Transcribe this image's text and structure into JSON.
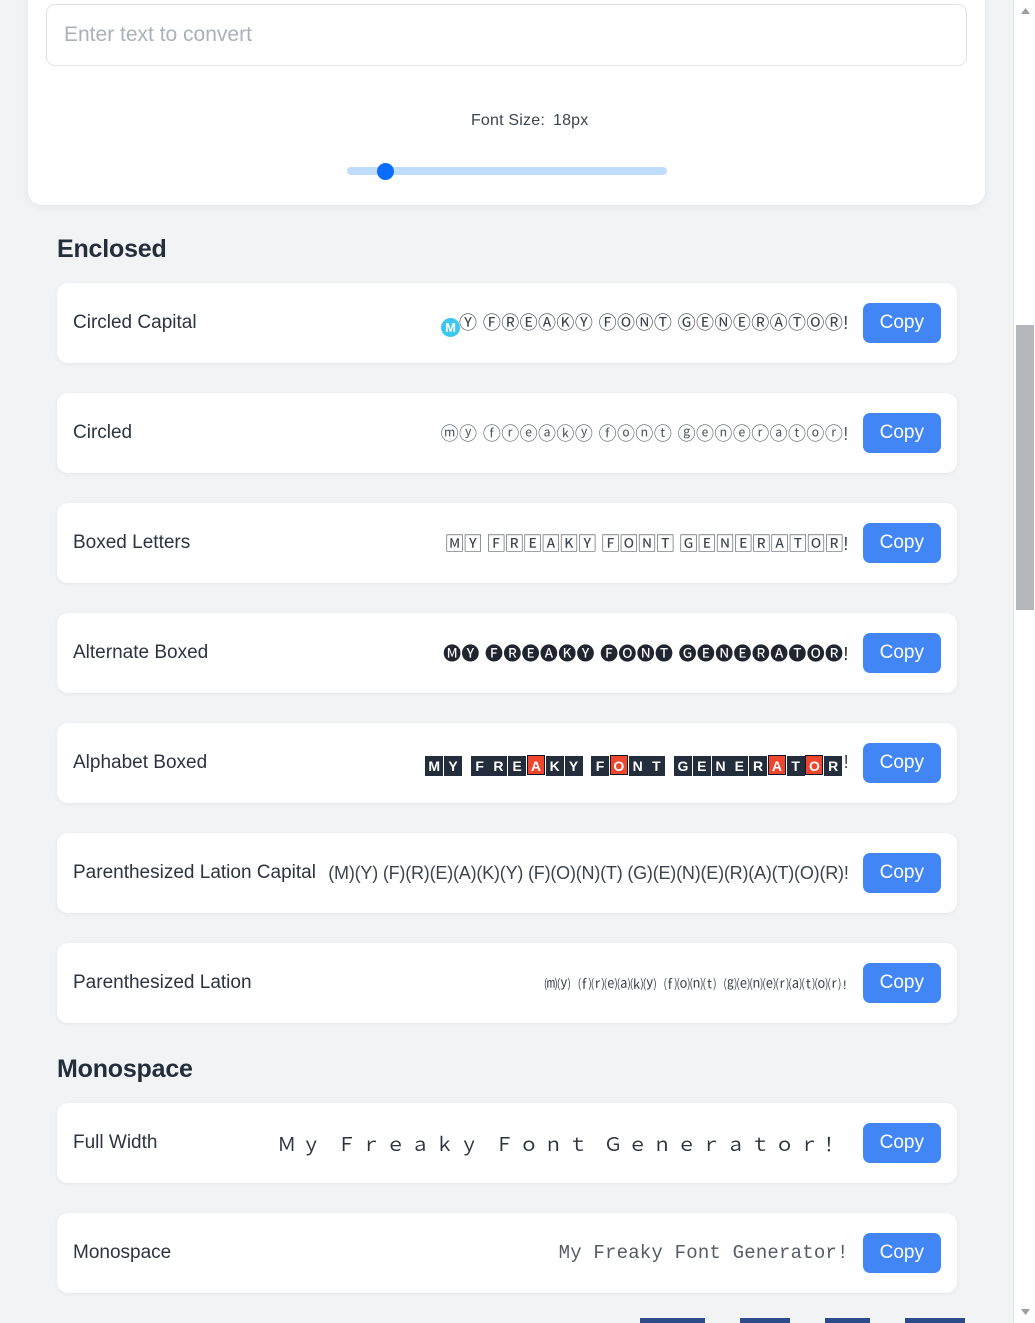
{
  "app": {
    "background_color": "#f1f3f5",
    "accent_color": "#4285f4"
  },
  "input_card": {
    "placeholder": "Enter text to convert",
    "value": "",
    "slider": {
      "label": "Font Size:",
      "value_label": "18px",
      "value": 18,
      "min": 10,
      "max": 72,
      "percent": 12,
      "track_color": "#bfdbfe",
      "thumb_color": "#0b6efd"
    }
  },
  "sections": [
    {
      "title": "Enclosed",
      "rows": [
        {
          "label": "Circled Capital",
          "preview": "Ⓜ",
          "preview_rest": "Ⓨ ⒻⓇⒺⒶⓀⓎ ⒻⓄⓃⓉ ⒼⒺⓃⒺⓇⒶⓉⓄⓇ!",
          "style": "pv-circled-cap",
          "copy_label": "Copy"
        },
        {
          "label": "Circled",
          "preview": "ⓜⓨ ⓕⓡⓔⓐⓚⓨ ⓕⓞⓝⓣ ⓖⓔⓝⓔⓡⓐⓣⓞⓡ!",
          "style": "pv-circled",
          "copy_label": "Copy"
        },
        {
          "label": "Boxed Letters",
          "preview": "🄼🅈 🄵🅁🄴🄰🄺🅈 🄵🄾🄽🅃 🄶🄴🄽🄴🅁🄰🅃🄾🅁!",
          "style": "pv-boxed",
          "copy_label": "Copy"
        },
        {
          "label": "Alternate Boxed",
          "preview": "🅜🅨 🅕🅡🅔🅐🅚🅨 🅕🅞🅝🅣 🅖🅔🅝🅔🅡🅐🅣🅞🅡!",
          "style": "pv-alt-boxed",
          "copy_label": "Copy"
        },
        {
          "label": "Alphabet Boxed",
          "preview": "MY FREAKY FONT GENERATOR!",
          "tiles": [
            {
              "ch": "M",
              "vowel": false
            },
            {
              "ch": "Y",
              "vowel": false
            },
            {
              "ch": " ",
              "vowel": false
            },
            {
              "ch": "F",
              "vowel": false
            },
            {
              "ch": "R",
              "vowel": false
            },
            {
              "ch": "E",
              "vowel": false
            },
            {
              "ch": "A",
              "vowel": true
            },
            {
              "ch": "K",
              "vowel": false
            },
            {
              "ch": "Y",
              "vowel": false
            },
            {
              "ch": " ",
              "vowel": false
            },
            {
              "ch": "F",
              "vowel": false
            },
            {
              "ch": "O",
              "vowel": true
            },
            {
              "ch": "N",
              "vowel": false
            },
            {
              "ch": "T",
              "vowel": false
            },
            {
              "ch": " ",
              "vowel": false
            },
            {
              "ch": "G",
              "vowel": false
            },
            {
              "ch": "E",
              "vowel": false
            },
            {
              "ch": "N",
              "vowel": false
            },
            {
              "ch": "E",
              "vowel": false
            },
            {
              "ch": "R",
              "vowel": false
            },
            {
              "ch": "A",
              "vowel": true
            },
            {
              "ch": "T",
              "vowel": false
            },
            {
              "ch": "O",
              "vowel": true
            },
            {
              "ch": "R",
              "vowel": false
            }
          ],
          "trailing": "!",
          "style": "pv-alpha-boxed",
          "tile_color": "#242d3c",
          "vowel_color": "#f0462d",
          "copy_label": "Copy"
        },
        {
          "label": "Parenthesized Lation Capital",
          "preview": "(M)(Y) (F)(R)(E)(A)(K)(Y) (F)(O)(N)(T) (G)(E)(N)(E)(R)(A)(T)(O)(R)!",
          "style": "pv-paren-cap",
          "copy_label": "Copy"
        },
        {
          "label": "Parenthesized Lation",
          "preview": "⒨⒴ ⒡⒭⒠⒜⒦⒴ ⒡⒪⒩⒯ ⒢⒠⒩⒠⒭⒜⒯⒪⒭!",
          "style": "pv-paren-low",
          "copy_label": "Copy"
        }
      ]
    },
    {
      "title": "Monospace",
      "rows": [
        {
          "label": "Full Width",
          "preview": "Ｍｙ Ｆｒｅａｋｙ Ｆｏｎｔ Ｇｅｎｅｒａｔｏｒ！",
          "style": "pv-fullwidth",
          "copy_label": "Copy"
        },
        {
          "label": "Monospace",
          "preview": "My Freaky Font Generator!",
          "style": "pv-mono",
          "copy_label": "Copy"
        }
      ]
    }
  ],
  "scrollbar": {
    "up_arrow": "▲",
    "down_arrow": "▼",
    "thumb_color": "#b4b7bb"
  }
}
